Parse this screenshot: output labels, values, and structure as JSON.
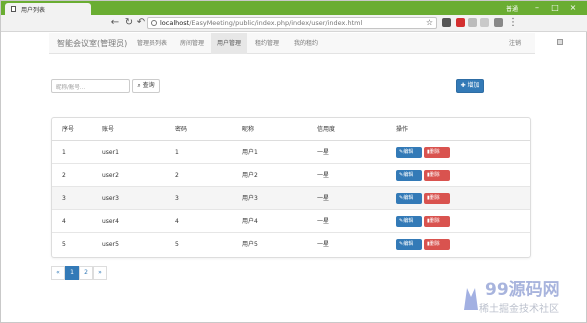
{
  "browser": {
    "tab_title": "用户列表",
    "window_user": "普通",
    "url_host": "localhost",
    "url_path": "/EasyMeeting/public/index.php/index/user/index.html"
  },
  "navbar": {
    "brand": "智能会议室(管理员)",
    "items": [
      {
        "label": "管理员列表"
      },
      {
        "label": "房间管理"
      },
      {
        "label": "用户管理"
      },
      {
        "label": "租约管理"
      },
      {
        "label": "我的租约"
      }
    ],
    "active_index": 2,
    "logout_label": "注销"
  },
  "search": {
    "placeholder": "昵称/账号...",
    "button_label": "查询"
  },
  "add_button_label": "增加",
  "table": {
    "headers": [
      "序号",
      "账号",
      "密码",
      "昵称",
      "信用度",
      "操作"
    ],
    "rows": [
      {
        "index": "1",
        "account": "user1",
        "password": "1",
        "nickname": "用户1",
        "credit": "一星"
      },
      {
        "index": "2",
        "account": "user2",
        "password": "2",
        "nickname": "用户2",
        "credit": "一星"
      },
      {
        "index": "3",
        "account": "user3",
        "password": "3",
        "nickname": "用户3",
        "credit": "一星"
      },
      {
        "index": "4",
        "account": "user4",
        "password": "4",
        "nickname": "用户4",
        "credit": "一星"
      },
      {
        "index": "5",
        "account": "user5",
        "password": "5",
        "nickname": "用户5",
        "credit": "一星"
      }
    ],
    "edit_label": "编辑",
    "delete_label": "删除"
  },
  "pagination": {
    "prev": "«",
    "pages": [
      "1",
      "2"
    ],
    "current": "1",
    "next": "»"
  },
  "watermark": {
    "line1": "99源码网",
    "line2": "稀土掘金技术社区"
  },
  "colors": {
    "primary": "#337ab7",
    "danger": "#d9534f",
    "titlebar": "#6aad32"
  }
}
